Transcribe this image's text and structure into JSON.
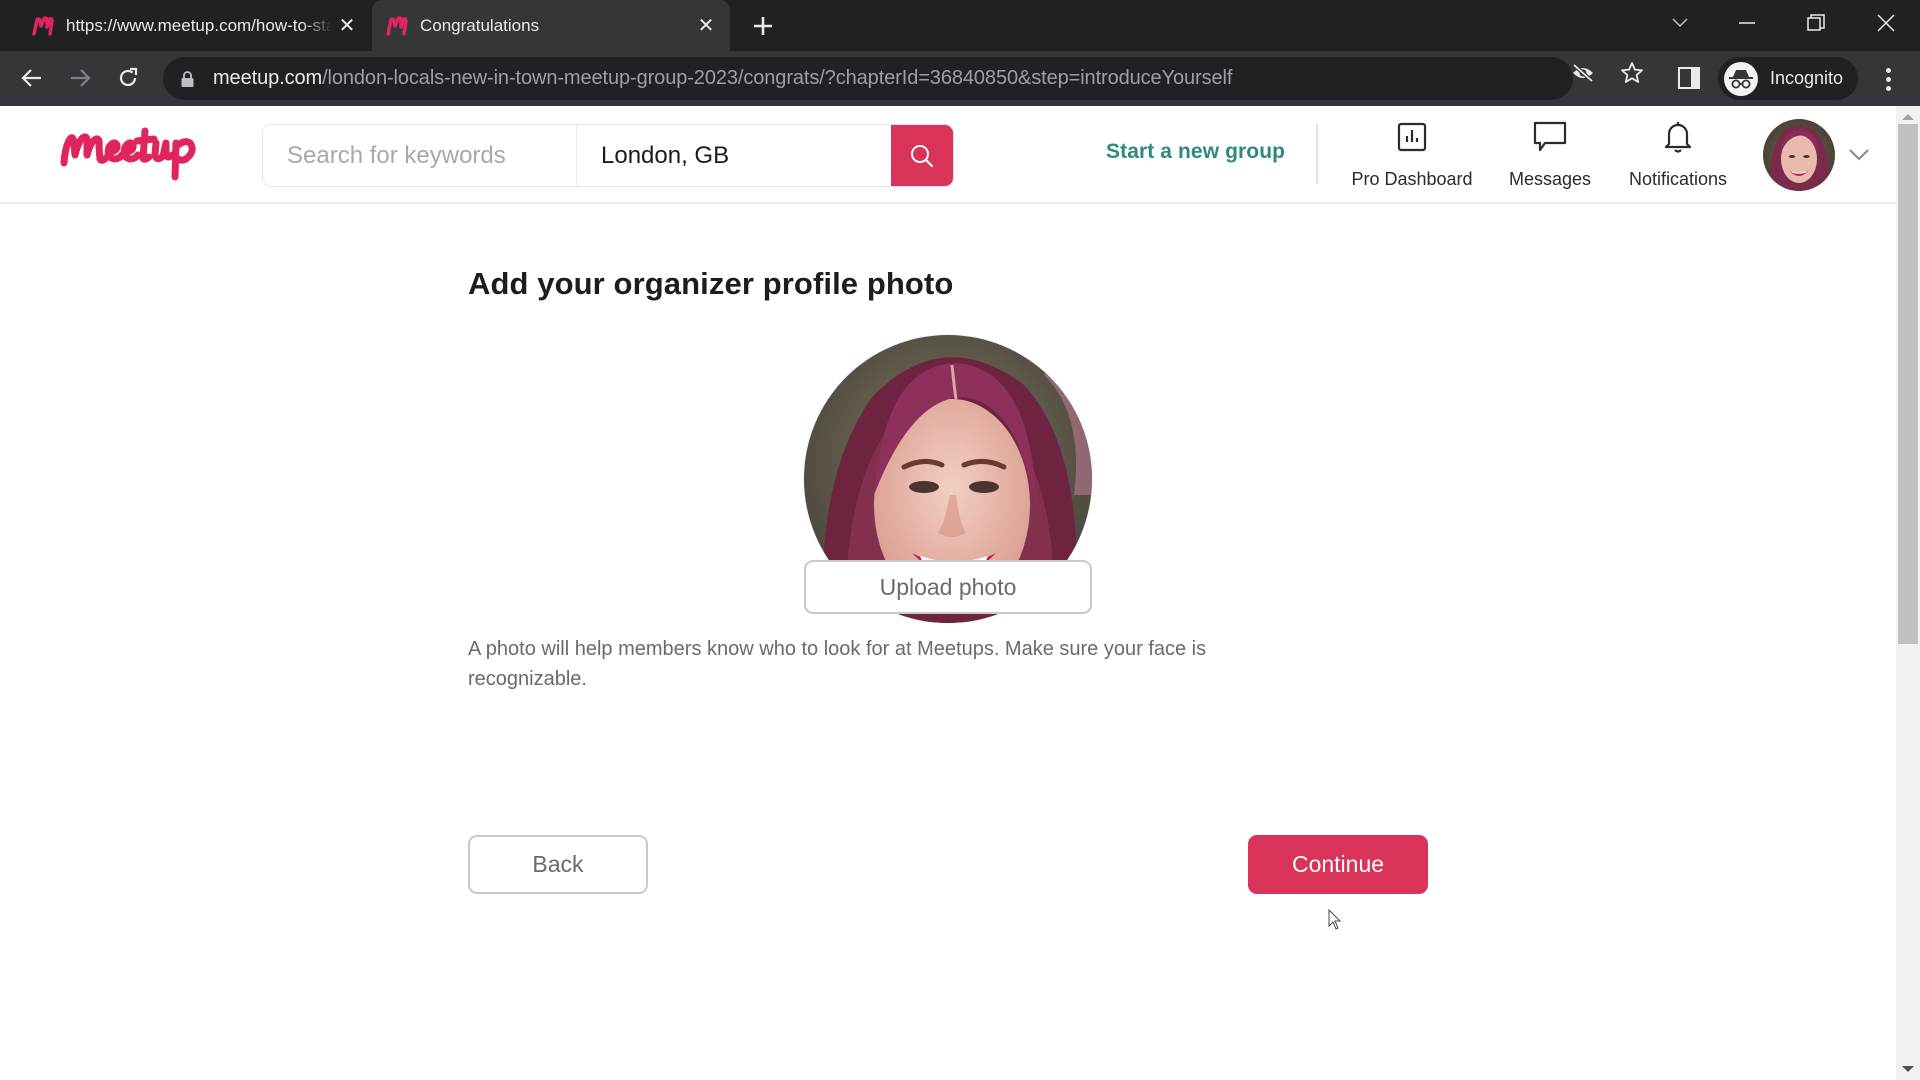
{
  "browser": {
    "tabs": [
      {
        "title": "https://www.meetup.com/how-to-start-a-group",
        "active": false,
        "favicon": "meetup-favicon"
      },
      {
        "title": "Congratulations",
        "active": true,
        "favicon": "meetup-favicon"
      }
    ],
    "new_tab_icon": "plus-icon",
    "window_controls": [
      "tab-search-icon",
      "minimize-icon",
      "restore-icon",
      "close-icon"
    ],
    "url": {
      "host": "meetup.com",
      "path": "/london-locals-new-in-town-meetup-group-2023/congrats/?chapterId=36840850&step=introduceYourself"
    },
    "profile_label": "Incognito"
  },
  "header": {
    "logo_text": "Meetup",
    "search": {
      "keywords_placeholder": "Search for keywords",
      "keywords_value": "",
      "location_value": "London, GB"
    },
    "start_group_label": "Start a new group",
    "nav": [
      {
        "label": "Pro Dashboard",
        "icon": "bar-chart-icon"
      },
      {
        "label": "Messages",
        "icon": "chat-bubble-icon"
      },
      {
        "label": "Notifications",
        "icon": "bell-icon"
      }
    ]
  },
  "main": {
    "title": "Add your organizer profile photo",
    "upload_label": "Upload photo",
    "help_text": "A photo will help members know who to look for at Meetups. Make sure your face is recognizable.",
    "back_label": "Back",
    "continue_label": "Continue"
  },
  "colors": {
    "brand": "#da3359",
    "logo": "#e0245e",
    "start_group_link": "#2d8a7f",
    "chrome_dark": "#202124",
    "chrome_active": "#35363a"
  }
}
